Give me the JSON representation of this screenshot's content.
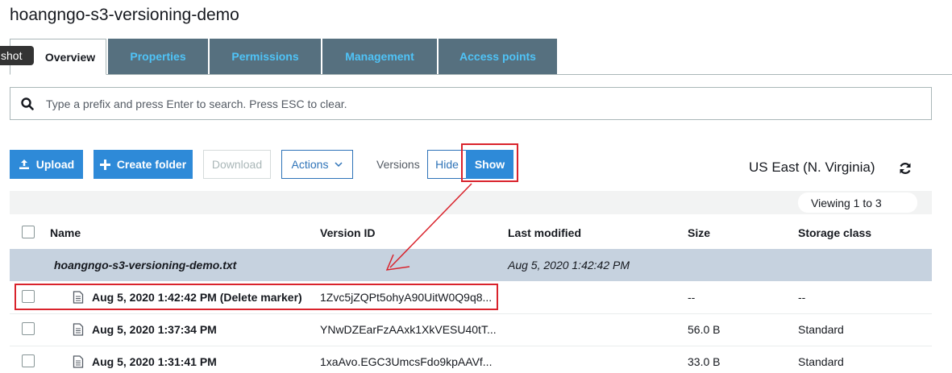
{
  "page": {
    "title": "hoangngo-s3-versioning-demo"
  },
  "tooltip": {
    "text": "shot"
  },
  "tabs": [
    {
      "label": "Overview",
      "active": true
    },
    {
      "label": "Properties",
      "active": false
    },
    {
      "label": "Permissions",
      "active": false
    },
    {
      "label": "Management",
      "active": false
    },
    {
      "label": "Access points",
      "active": false
    }
  ],
  "search": {
    "placeholder": "Type a prefix and press Enter to search. Press ESC to clear.",
    "value": ""
  },
  "toolbar": {
    "upload_label": "Upload",
    "create_folder_label": "Create folder",
    "download_label": "Download",
    "actions_label": "Actions",
    "versions_label": "Versions",
    "hide_label": "Hide",
    "show_label": "Show",
    "region": "US East (N. Virginia)"
  },
  "table": {
    "viewing": "Viewing 1 to 3",
    "columns": {
      "name": "Name",
      "version_id": "Version ID",
      "last_modified": "Last modified",
      "size": "Size",
      "storage_class": "Storage class"
    },
    "group": {
      "name": "hoangngo-s3-versioning-demo.txt",
      "last_modified": "Aug 5, 2020 1:42:42 PM"
    },
    "rows": [
      {
        "name": "Aug 5, 2020 1:42:42 PM (Delete marker)",
        "version_id": "1Zvc5jZQPt5ohyA90UitW0Q9q8...",
        "size": "--",
        "storage_class": "--"
      },
      {
        "name": "Aug 5, 2020 1:37:34 PM",
        "version_id": "YNwDZEarFzAAxk1XkVESU40tT...",
        "size": "56.0 B",
        "storage_class": "Standard"
      },
      {
        "name": "Aug 5, 2020 1:31:41 PM",
        "version_id": "1xaAvo.EGC3UmcsFdo9kpAAVf...",
        "size": "33.0 B",
        "storage_class": "Standard"
      }
    ]
  },
  "colors": {
    "accent": "#2e8ad8",
    "tab_bg": "#56707f",
    "tab_text": "#4fc3f7",
    "annotation": "#d9232c",
    "group_row": "#c6d2df"
  }
}
